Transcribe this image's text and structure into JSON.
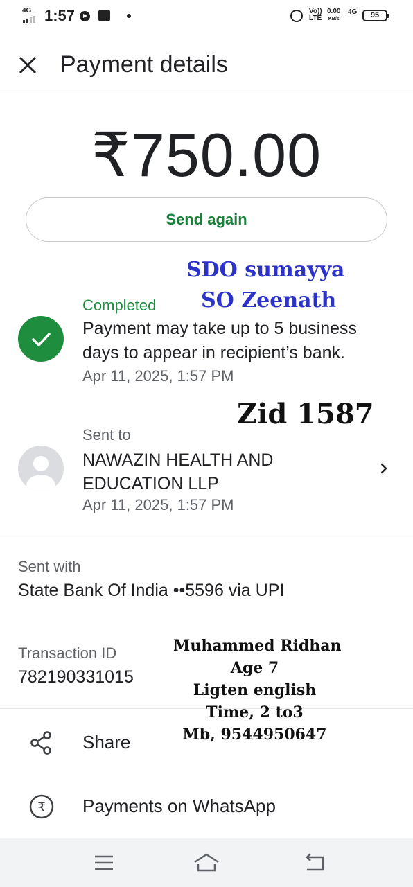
{
  "status_bar": {
    "network": "4G",
    "time": "1:57",
    "volte": "Vo)) LTE",
    "speed": "0.00",
    "speed_unit": "KB/s",
    "net_type": "4G",
    "battery": "95"
  },
  "header": {
    "title": "Payment details"
  },
  "payment": {
    "amount": "₹750.00",
    "send_again_label": "Send again"
  },
  "status": {
    "label": "Completed",
    "description": "Payment may take up to 5 business days to appear in recipient’s bank.",
    "timestamp": "Apr 11, 2025, 1:57 PM"
  },
  "recipient": {
    "label": "Sent to",
    "name": "NAWAZIN HEALTH AND EDUCATION LLP",
    "timestamp": "Apr 11, 2025, 1:57 PM"
  },
  "sent_with": {
    "label": "Sent with",
    "value": "State Bank Of India ••5596 via UPI"
  },
  "transaction": {
    "label": "Transaction ID",
    "value": "782190331015"
  },
  "actions": {
    "share_label": "Share",
    "whatsapp_label": "Payments on WhatsApp"
  },
  "annotations": {
    "line1": "SDO sumayya",
    "line2": "SO Zeenath",
    "zid": "Zid 1587",
    "note": [
      "Muhammed Ridhan",
      "Age 7",
      "Ligten  english",
      "Time, 2 to3",
      "Mb, 9544950647"
    ]
  },
  "colors": {
    "accent_green": "#1e8e3e",
    "annotation_blue": "#2d33c9"
  }
}
